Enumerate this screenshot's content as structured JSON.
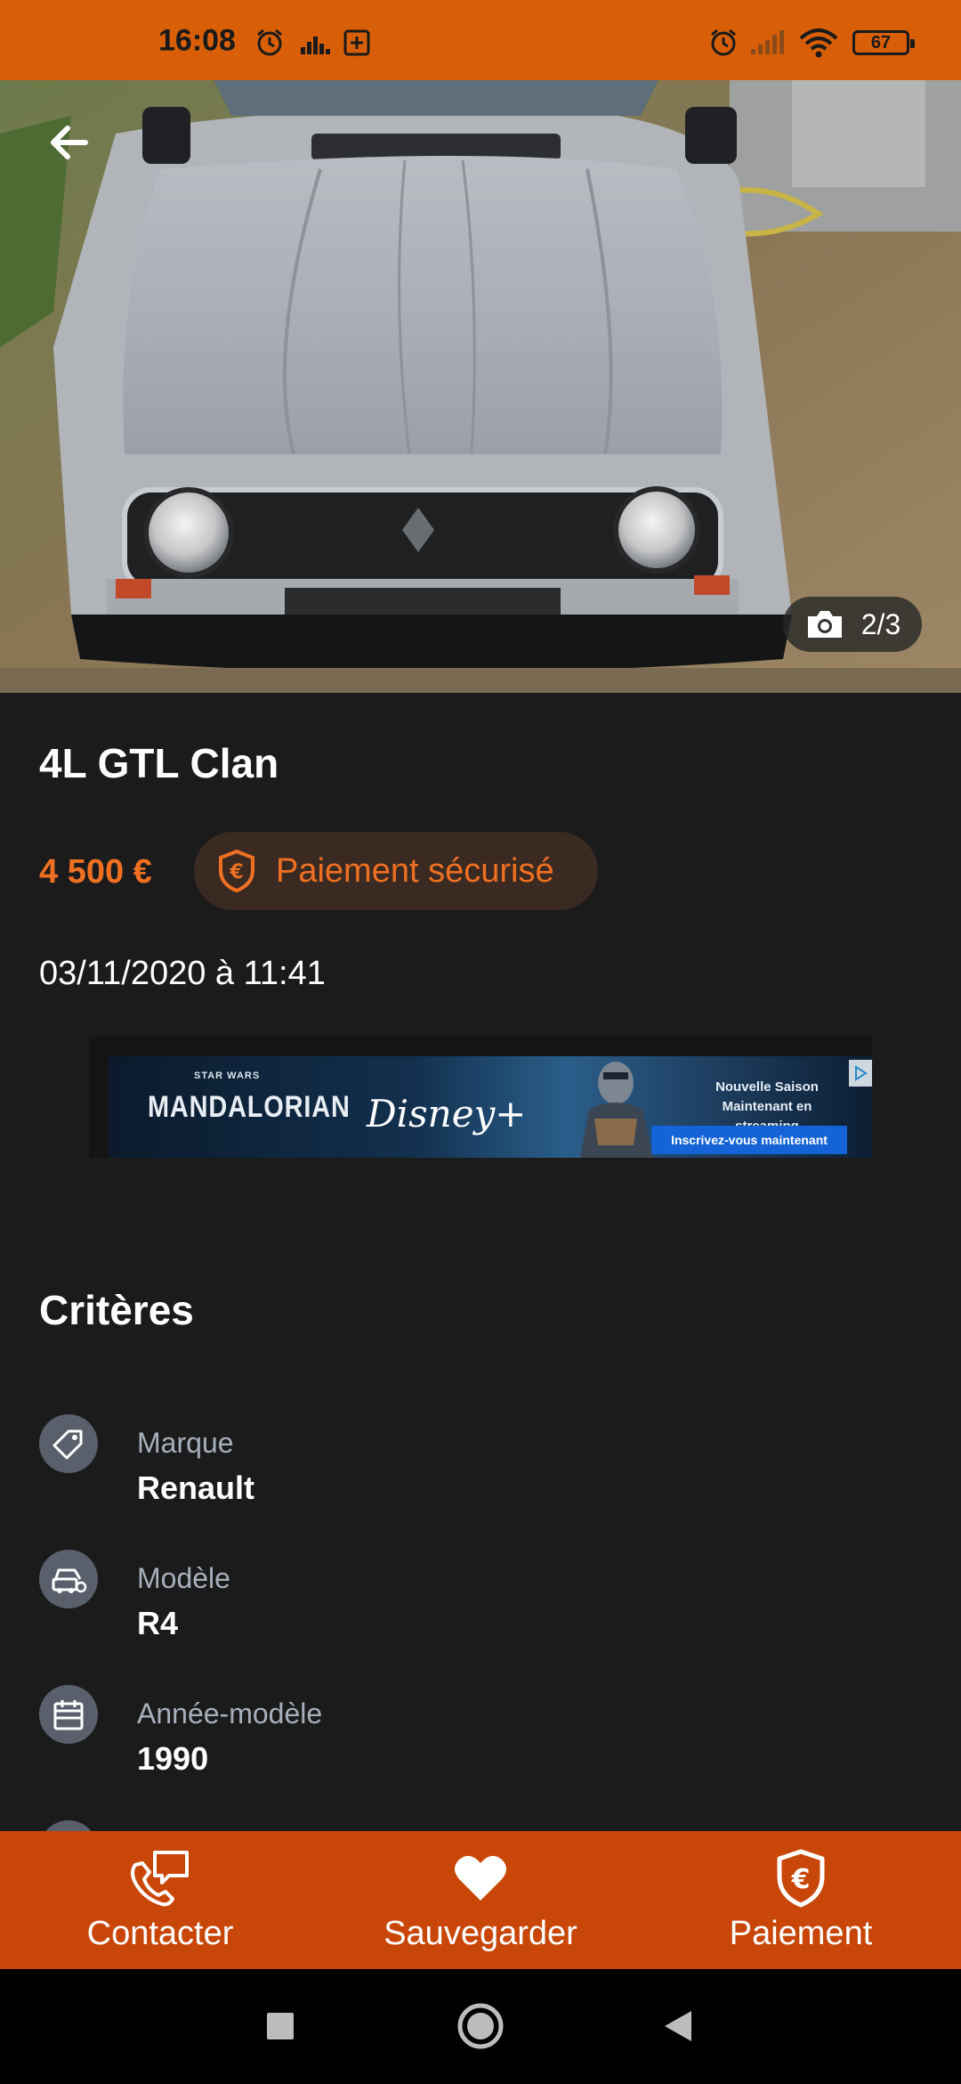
{
  "status_bar": {
    "time": "16:08",
    "battery": "67",
    "icons": [
      "alarm-icon",
      "equalizer-icon",
      "plus-box-icon",
      "alarm-icon",
      "signal-icon",
      "wifi-icon",
      "battery-icon"
    ]
  },
  "hero": {
    "photo_counter": "2/3",
    "icons": [
      "back-arrow-icon",
      "camera-icon"
    ]
  },
  "listing": {
    "title": "4L GTL Clan",
    "price": "4 500 €",
    "secure_payment_label": "Paiement sécurisé",
    "date": "03/11/2020 à 11:41"
  },
  "ad": {
    "star_wars": "STAR WARS",
    "show": "MANDALORIAN",
    "brand": "Disney+",
    "season_line1": "Nouvelle Saison",
    "season_line2": "Maintenant en streaming",
    "cta": "Inscrivez-vous maintenant"
  },
  "criteria": {
    "title": "Critères",
    "items": [
      {
        "label": "Marque",
        "value": "Renault",
        "icon": "tag-icon"
      },
      {
        "label": "Modèle",
        "value": "R4",
        "icon": "car-icon"
      },
      {
        "label": "Année-modèle",
        "value": "1990",
        "icon": "calendar-icon"
      }
    ]
  },
  "bottom_bar": {
    "items": [
      {
        "label": "Contacter",
        "icon": "phone-chat-icon"
      },
      {
        "label": "Sauvegarder",
        "icon": "heart-icon"
      },
      {
        "label": "Paiement",
        "icon": "shield-euro-icon"
      }
    ]
  },
  "colors": {
    "status_bar": "#d85f08",
    "bottom_bar": "#c84608",
    "accent": "#f07022",
    "background": "#1b1b1c"
  }
}
